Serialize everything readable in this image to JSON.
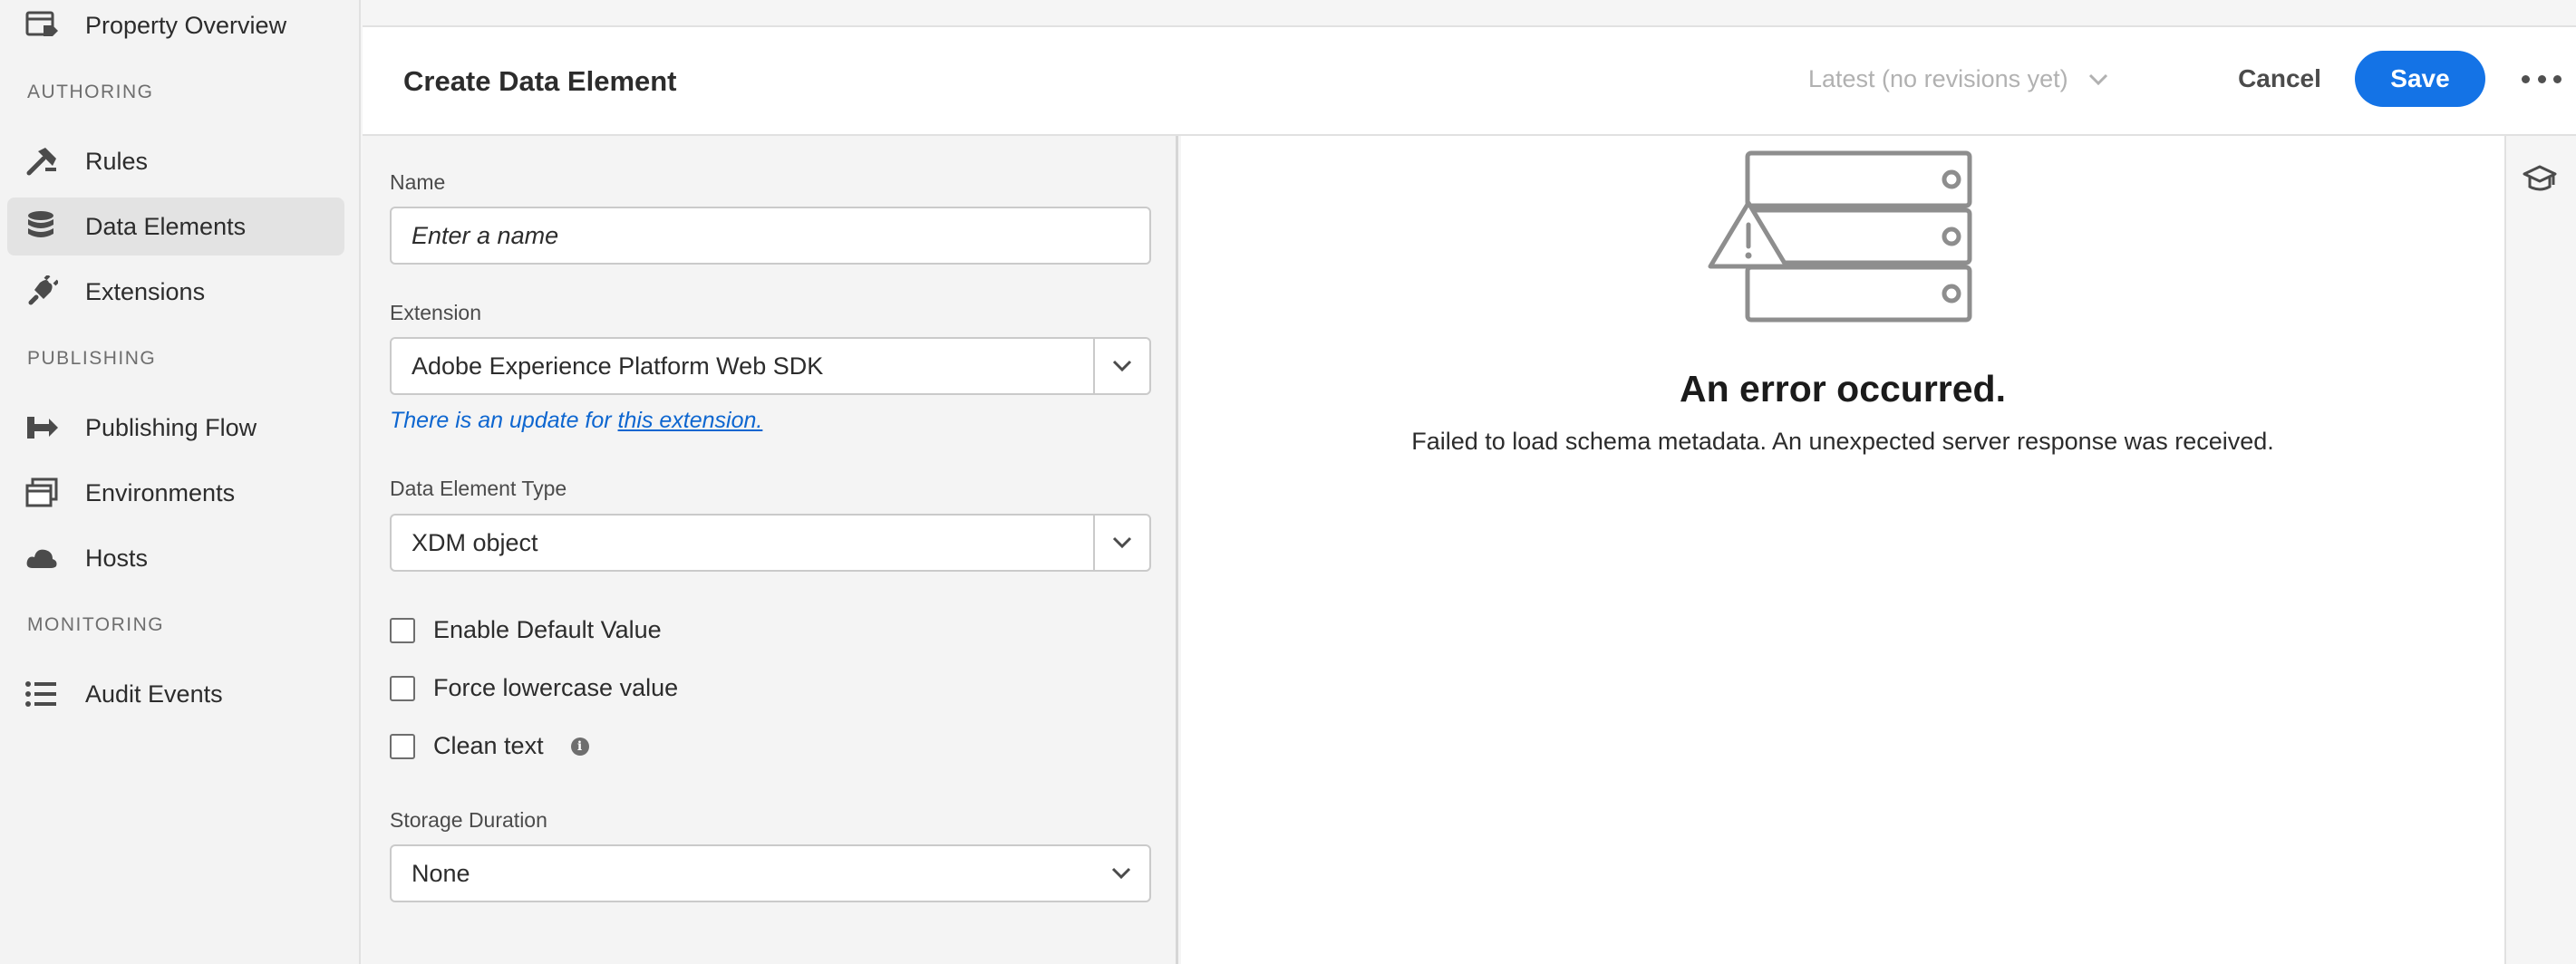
{
  "sidebar": {
    "items": [
      {
        "label": "Property Overview",
        "icon": "property-overview-icon"
      },
      {
        "label": "Rules",
        "icon": "rules-icon"
      },
      {
        "label": "Data Elements",
        "icon": "data-elements-icon",
        "active": true
      },
      {
        "label": "Extensions",
        "icon": "extensions-icon"
      },
      {
        "label": "Publishing Flow",
        "icon": "publishing-flow-icon"
      },
      {
        "label": "Environments",
        "icon": "environments-icon"
      },
      {
        "label": "Hosts",
        "icon": "hosts-icon"
      },
      {
        "label": "Audit Events",
        "icon": "audit-events-icon"
      }
    ],
    "sections": {
      "authoring": "AUTHORING",
      "publishing": "PUBLISHING",
      "monitoring": "MONITORING"
    }
  },
  "header": {
    "title": "Create Data Element",
    "revision": "Latest (no revisions yet)",
    "cancel_label": "Cancel",
    "save_label": "Save"
  },
  "form": {
    "name_label": "Name",
    "name_placeholder": "Enter a name",
    "extension_label": "Extension",
    "extension_value": "Adobe Experience Platform Web SDK",
    "update_note_prefix": "There is an update for ",
    "update_note_link": "this extension.",
    "type_label": "Data Element Type",
    "type_value": "XDM object",
    "checkboxes": {
      "default_value": "Enable Default Value",
      "lowercase": "Force lowercase value",
      "clean_text": "Clean text"
    },
    "storage_label": "Storage Duration",
    "storage_value": "None"
  },
  "error": {
    "title": "An error occurred.",
    "message": "Failed to load schema metadata. An unexpected server response was received."
  },
  "colors": {
    "accent": "#1473e6",
    "link": "#0d66d0",
    "sidebar_bg": "#f3f3f3",
    "active_item_bg": "#e3e3e3"
  }
}
